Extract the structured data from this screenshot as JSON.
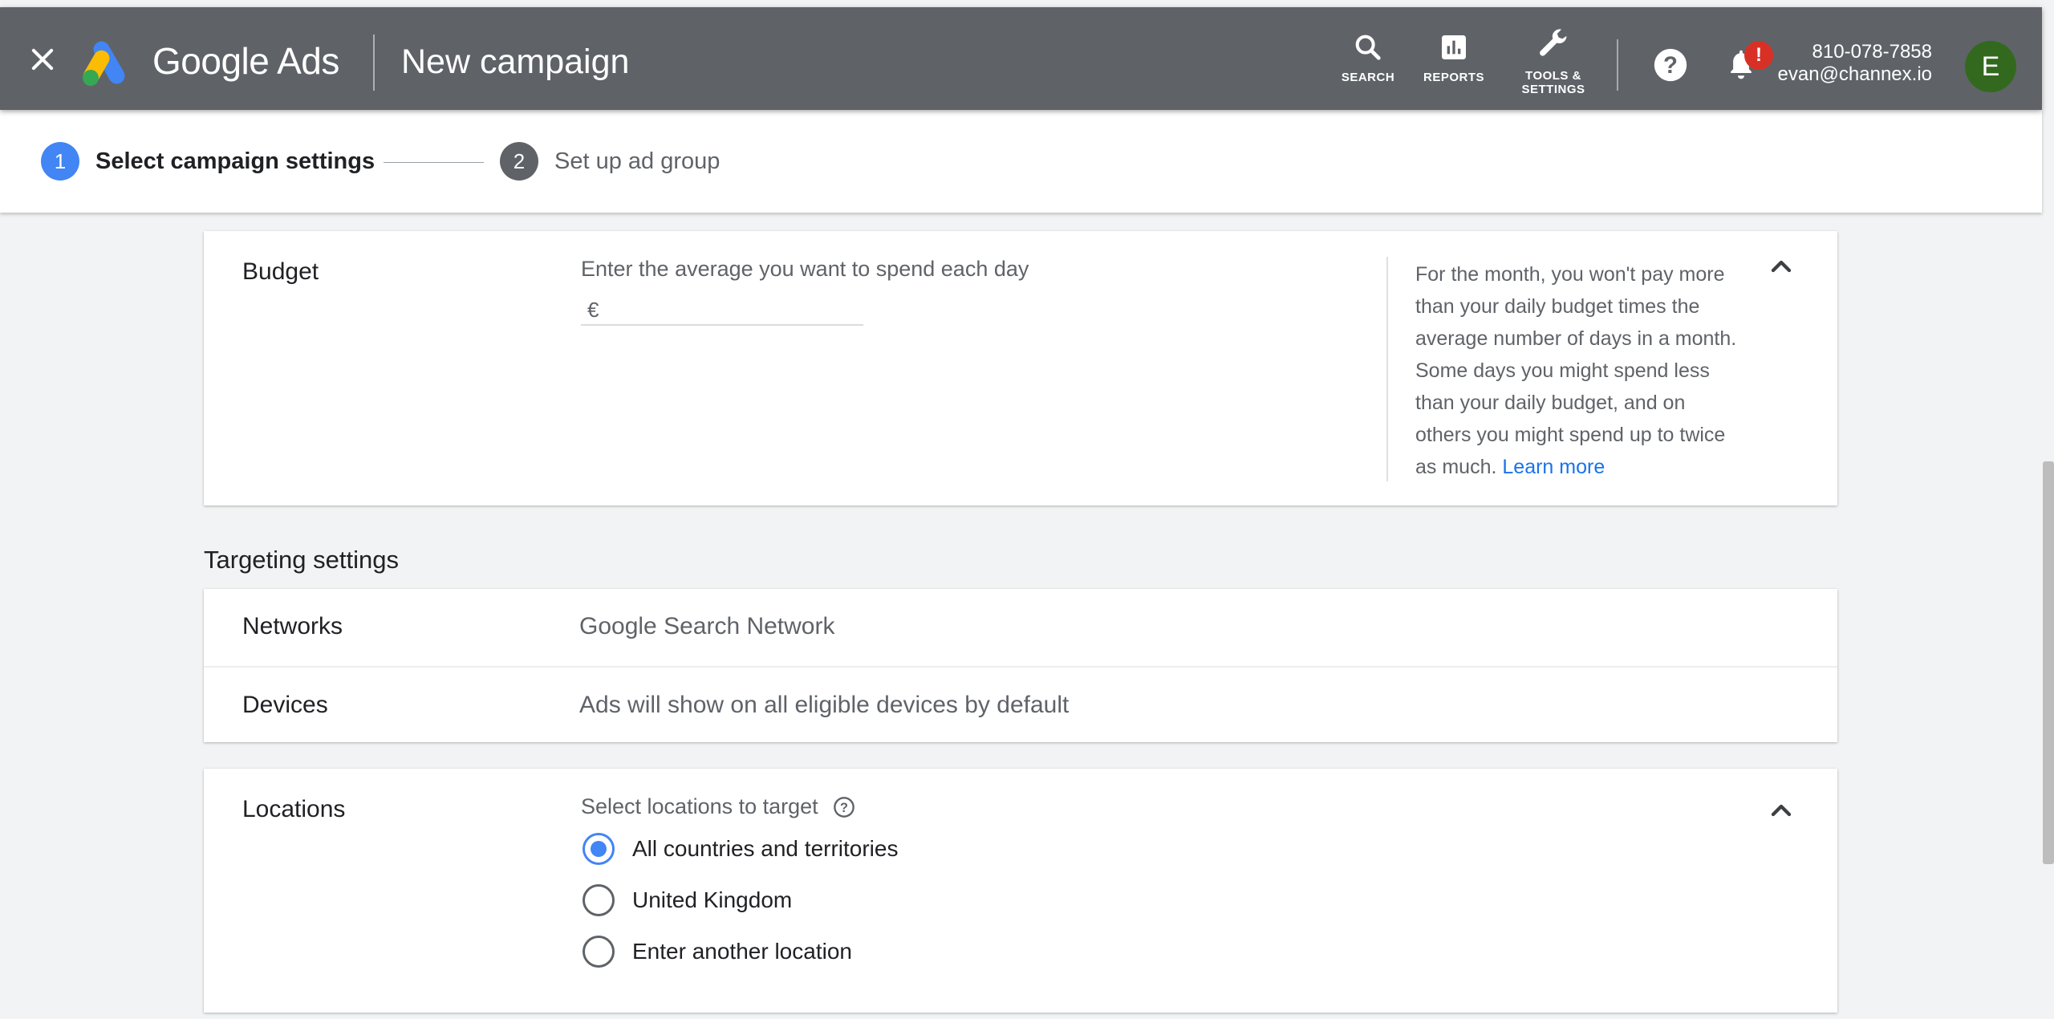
{
  "header": {
    "brand": "Google Ads",
    "title": "New campaign",
    "tools": {
      "search": "SEARCH",
      "reports": "REPORTS",
      "settings_line1": "TOOLS &",
      "settings_line2": "SETTINGS"
    },
    "notification_badge": "!",
    "account": {
      "phone": "810-078-7858",
      "email": "evan@channex.io",
      "avatar_letter": "E"
    }
  },
  "stepper": {
    "steps": [
      {
        "number": "1",
        "label": "Select campaign settings",
        "state": "active"
      },
      {
        "number": "2",
        "label": "Set up ad group",
        "state": "inactive"
      }
    ]
  },
  "budget": {
    "label": "Budget",
    "hint": "Enter the average you want to spend each day",
    "currency": "€",
    "value": "",
    "info": "For the month, you won't pay more than your daily budget times the average number of days in a month. Some days you might spend less than your daily budget, and on others you might spend up to twice as much.",
    "info_link": "Learn more"
  },
  "targeting": {
    "title": "Targeting settings",
    "rows": [
      {
        "label": "Networks",
        "value": "Google Search Network"
      },
      {
        "label": "Devices",
        "value": "Ads will show on all eligible devices by default"
      }
    ]
  },
  "locations": {
    "label": "Locations",
    "prompt": "Select locations to target",
    "options": [
      {
        "label": "All countries and territories",
        "selected": true
      },
      {
        "label": "United Kingdom",
        "selected": false
      },
      {
        "label": "Enter another location",
        "selected": false
      }
    ]
  },
  "colors": {
    "topbar": "#5f6368",
    "accent": "#4285f4",
    "link": "#1a73e8",
    "badge": "#d93025",
    "avatar": "#33691e"
  }
}
